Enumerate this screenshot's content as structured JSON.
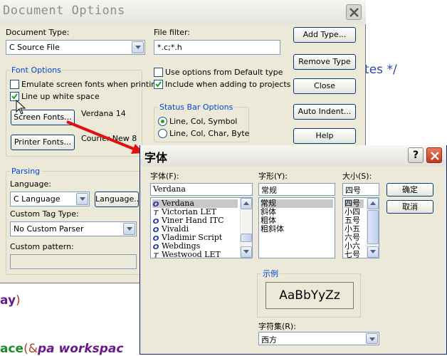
{
  "background_code": {
    "bytes_comment": "ytes */",
    "line1": {
      "ident": "ay",
      "paren": ")"
    },
    "line2": {
      "ident": "ace",
      "open": "(&",
      "arg": "pa",
      "rest": "workspac"
    }
  },
  "doc_options": {
    "title": "Document Options",
    "document_type_label": "Document Type:",
    "document_type_value": "C Source File",
    "file_filter_label": "File filter:",
    "file_filter_value": "*.c;*.h",
    "buttons": {
      "add_type": "Add Type...",
      "remove_type": "Remove Type",
      "close": "Close",
      "auto_indent": "Auto Indent...",
      "help": "Help"
    },
    "font_options": {
      "title": "Font Options",
      "emulate_label": "Emulate screen fonts when printing",
      "emulate_checked": false,
      "lineup_label": "Line up white space",
      "lineup_checked": true,
      "screen_fonts_button": "Screen Fonts...",
      "screen_font_value": "Verdana 14",
      "printer_fonts_button": "Printer Fonts...",
      "printer_font_value": "Courier New 8"
    },
    "use_default_label": "Use options from Default type",
    "use_default_checked": false,
    "include_projects_label": "Include when adding to projects",
    "include_projects_checked": true,
    "status_bar": {
      "title": "Status Bar Options",
      "option1": "Line, Col, Symbol",
      "option2": "Line, Col, Char, Byte",
      "selected": 1
    },
    "parsing": {
      "title": "Parsing",
      "language_label": "Language:",
      "language_value": "C Language",
      "language_button": "Language...",
      "custom_tag_label": "Custom Tag Type:",
      "custom_tag_value": "No Custom Parser",
      "custom_pattern_label": "Custom pattern:",
      "custom_pattern_value": ""
    }
  },
  "font_dialog": {
    "title": "字体",
    "font_label": "字体(F):",
    "font_value": "Verdana",
    "font_list": [
      {
        "name": "Verdana",
        "icon": "O",
        "selected": true
      },
      {
        "name": "Victorian LET",
        "icon": "T",
        "selected": false
      },
      {
        "name": "Viner Hand ITC",
        "icon": "O",
        "selected": false
      },
      {
        "name": "Vivaldi",
        "icon": "O",
        "selected": false
      },
      {
        "name": "Vladimir Script",
        "icon": "O",
        "selected": false
      },
      {
        "name": "Webdings",
        "icon": "O",
        "selected": false
      },
      {
        "name": "Westwood LET",
        "icon": "T",
        "selected": false
      }
    ],
    "style_label": "字形(Y):",
    "style_value": "常规",
    "style_list": [
      "常规",
      "斜体",
      "粗体",
      "粗斜体"
    ],
    "size_label": "大小(S):",
    "size_value": "四号",
    "size_list": [
      "四号",
      "小四",
      "五号",
      "小五",
      "六号",
      "小六",
      "七号"
    ],
    "ok_button": "确定",
    "cancel_button": "取消",
    "sample_label": "示例",
    "sample_text": "AaBbYyZz",
    "charset_label": "字符集(R):",
    "charset_value": "西方"
  },
  "colors": {
    "dialog_bg": "#ece9d8",
    "group_title": "#0046d5",
    "arrow": "#e01010"
  }
}
